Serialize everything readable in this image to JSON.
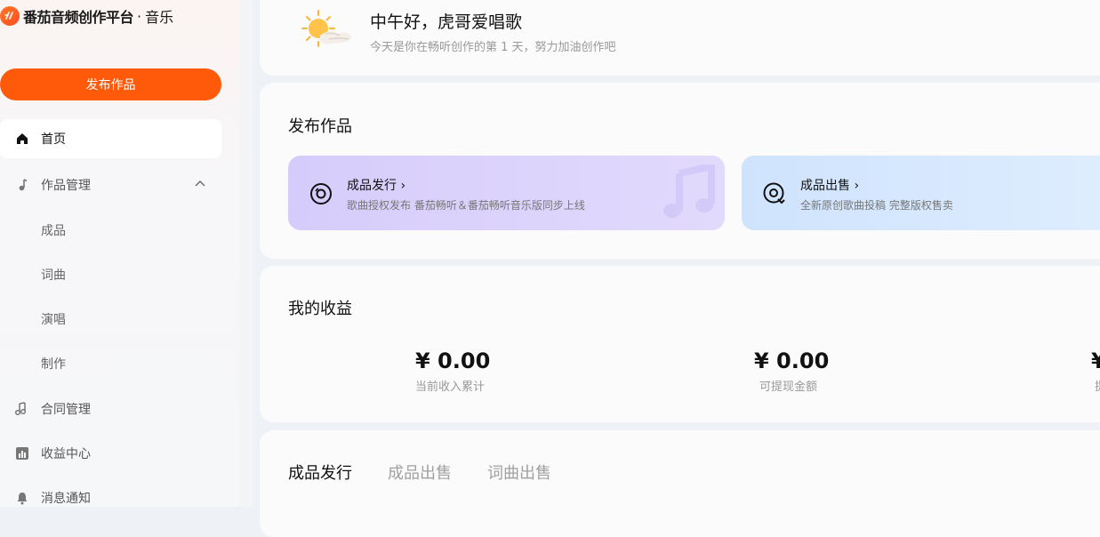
{
  "brand": {
    "title": "番茄音频创作平台",
    "dot": "·",
    "section": "音乐"
  },
  "sidebar": {
    "publish_button": "发布作品",
    "items": [
      {
        "label": "首页",
        "icon": "home-icon",
        "active": true
      },
      {
        "label": "作品管理",
        "icon": "music-note-icon",
        "expanded": true,
        "children": [
          "成品",
          "词曲",
          "演唱",
          "制作"
        ]
      },
      {
        "label": "合同管理",
        "icon": "contract-icon"
      },
      {
        "label": "收益中心",
        "icon": "bar-chart-icon"
      },
      {
        "label": "消息通知",
        "icon": "bell-icon"
      }
    ]
  },
  "greeting": {
    "title": "中午好，虎哥爱唱歌",
    "subtitle": "今天是你在畅听创作的第 1 天，努力加油创作吧"
  },
  "publish_section": {
    "title": "发布作品",
    "tiles": [
      {
        "title": "成品发行",
        "desc": "歌曲授权发布 番茄畅听＆番茄畅听音乐版同步上线",
        "icon": "disc-icon"
      },
      {
        "title": "成品出售",
        "desc": "全新原创歌曲投稿 完整版权售卖",
        "icon": "disc-sell-icon"
      }
    ]
  },
  "earnings": {
    "title": "我的收益",
    "items": [
      {
        "amount": "¥ 0.00",
        "label": "当前收入累计"
      },
      {
        "amount": "¥ 0.00",
        "label": "可提现金额"
      },
      {
        "amount": "¥",
        "label": "提"
      }
    ]
  },
  "tabs": [
    "成品发行",
    "成品出售",
    "词曲出售"
  ],
  "colors": {
    "accent": "#ff5a0a",
    "tile_purple": "#d6ccfb",
    "tile_blue": "#cfe3fd"
  }
}
